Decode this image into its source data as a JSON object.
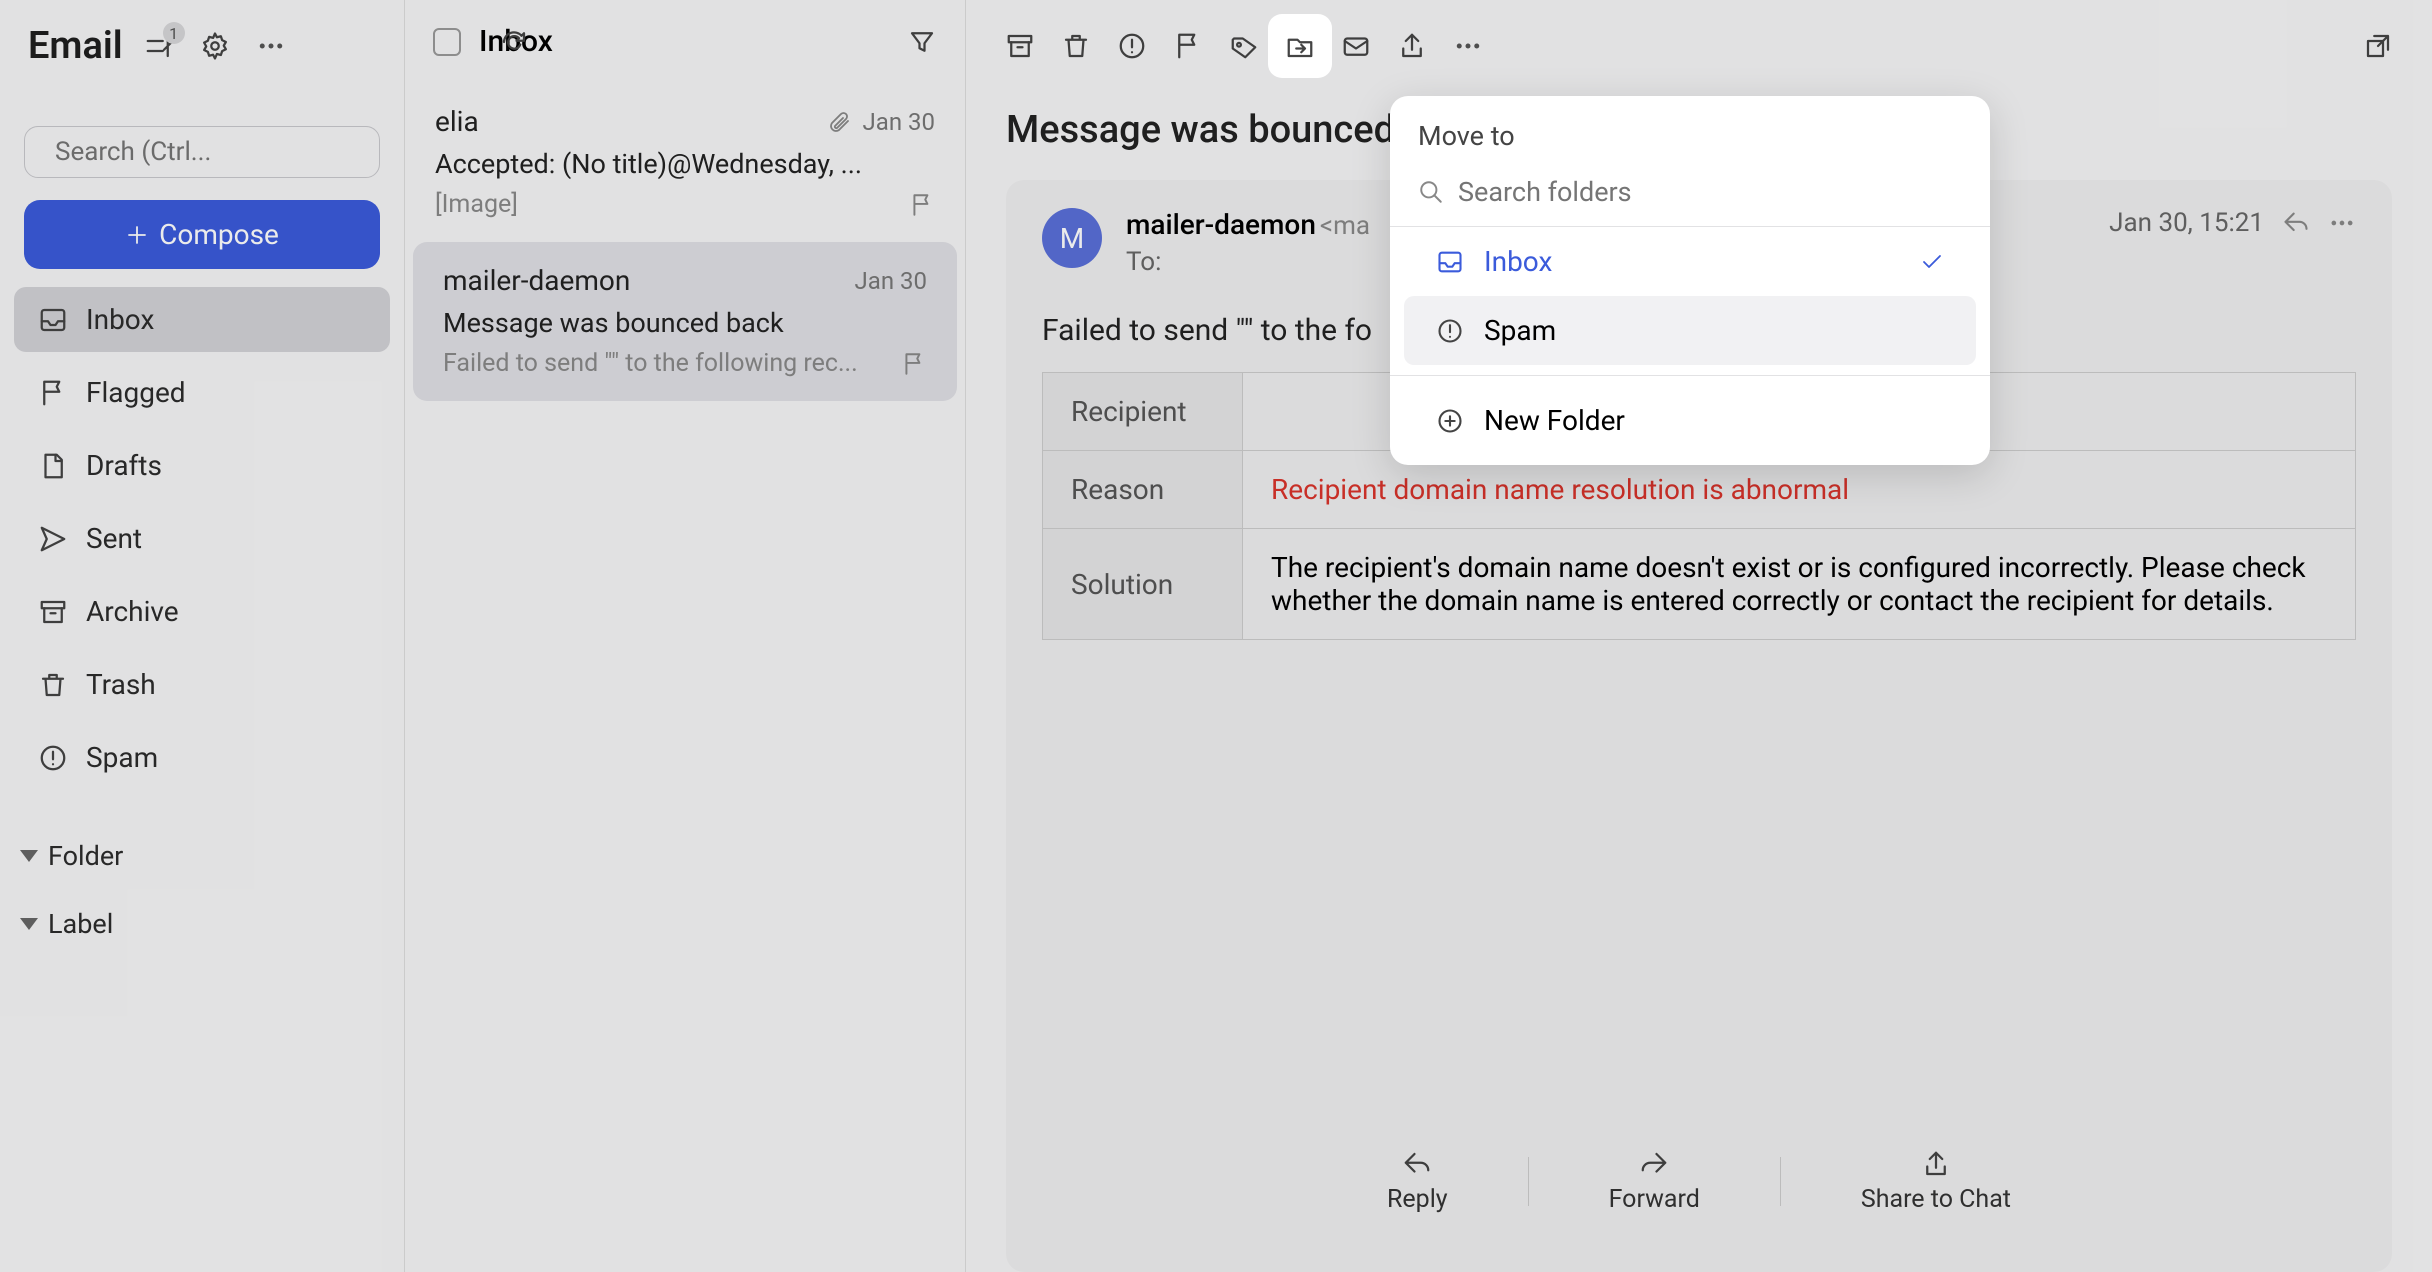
{
  "app": {
    "title": "Email",
    "sort_badge": "1"
  },
  "search": {
    "placeholder": "Search (Ctrl..."
  },
  "compose": {
    "label": "Compose"
  },
  "nav": {
    "inbox": "Inbox",
    "flagged": "Flagged",
    "drafts": "Drafts",
    "sent": "Sent",
    "archive": "Archive",
    "trash": "Trash",
    "spam": "Spam"
  },
  "sections": {
    "folder": "Folder",
    "label": "Label"
  },
  "list": {
    "title": "Inbox",
    "items": [
      {
        "sender": "elia",
        "date": "Jan 30",
        "subject": "Accepted: (No title)@Wednesday, ...",
        "preview": "[Image]",
        "has_attachment": true
      },
      {
        "sender": "mailer-daemon",
        "date": "Jan 30",
        "subject": "Message was bounced back",
        "preview": "Failed to send \"\" to the following rec...",
        "has_attachment": false
      }
    ]
  },
  "reader": {
    "subject": "Message was bounced b",
    "from_name": "mailer-daemon",
    "from_email": "<ma",
    "avatar_initial": "M",
    "to_label": "To:",
    "timestamp": "Jan 30, 15:21",
    "fail_line": "Failed to send \"\" to the fo",
    "table": {
      "recipient_key": "Recipient",
      "recipient_val": "",
      "reason_key": "Reason",
      "reason_val": "Recipient domain name resolution is abnormal",
      "solution_key": "Solution",
      "solution_val": "The recipient's domain name doesn't exist or is configured incorrectly. Please check whether the domain name is entered correctly or contact the recipient for details."
    },
    "actions": {
      "reply": "Reply",
      "forward": "Forward",
      "share": "Share to Chat"
    }
  },
  "popup": {
    "title": "Move to",
    "search_placeholder": "Search folders",
    "inbox": "Inbox",
    "spam": "Spam",
    "new_folder": "New Folder"
  }
}
